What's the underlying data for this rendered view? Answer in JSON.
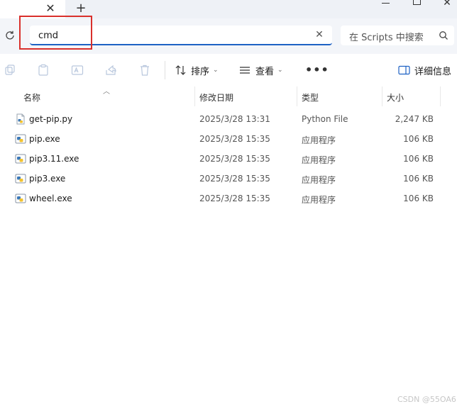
{
  "window": {
    "close_tab_glyph": "✕",
    "new_tab_glyph": "+",
    "close_glyph": "✕"
  },
  "address": {
    "value": "cmd",
    "clear_glyph": "✕"
  },
  "search": {
    "placeholder": "在 Scripts 中搜索"
  },
  "toolbar": {
    "sort_label": "排序",
    "view_label": "查看",
    "more_label": "•••",
    "details_label": "详细信息",
    "chevron": "⌄"
  },
  "columns": {
    "name": "名称",
    "date": "修改日期",
    "type": "类型",
    "size": "大小"
  },
  "files": [
    {
      "name": "get-pip.py",
      "date": "2025/3/28 13:31",
      "type": "Python File",
      "size": "2,247 KB",
      "icon": "python-file-icon"
    },
    {
      "name": "pip.exe",
      "date": "2025/3/28 15:35",
      "type": "应用程序",
      "size": "106 KB",
      "icon": "python-exe-icon"
    },
    {
      "name": "pip3.11.exe",
      "date": "2025/3/28 15:35",
      "type": "应用程序",
      "size": "106 KB",
      "icon": "python-exe-icon"
    },
    {
      "name": "pip3.exe",
      "date": "2025/3/28 15:35",
      "type": "应用程序",
      "size": "106 KB",
      "icon": "python-exe-icon"
    },
    {
      "name": "wheel.exe",
      "date": "2025/3/28 15:35",
      "type": "应用程序",
      "size": "106 KB",
      "icon": "python-exe-icon"
    }
  ],
  "watermark": "CSDN @55OA6",
  "colors": {
    "accent": "#1e62c4",
    "highlight": "#d9302c"
  }
}
